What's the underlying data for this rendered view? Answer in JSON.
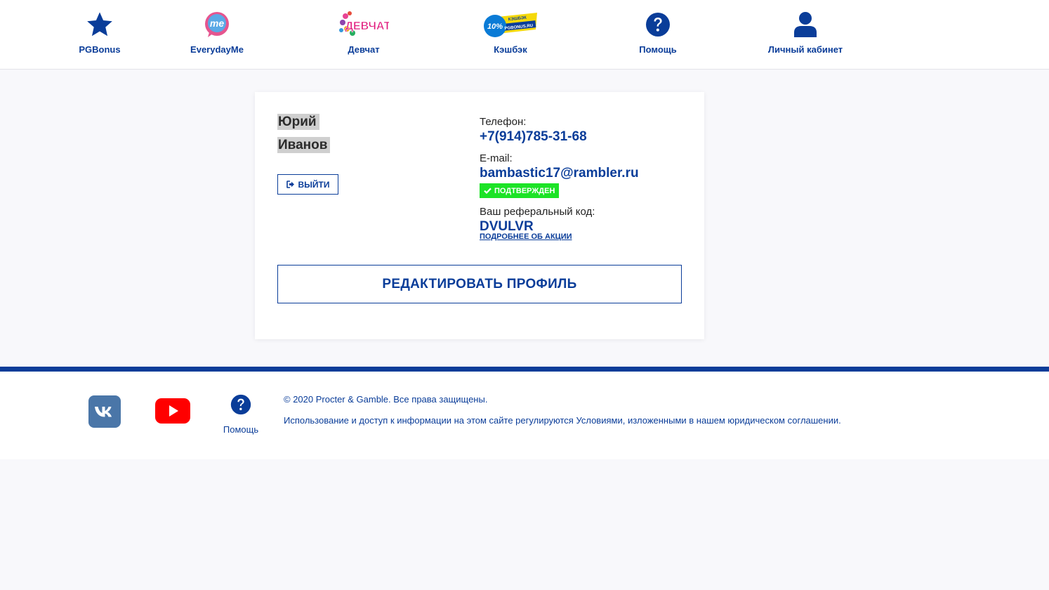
{
  "nav": {
    "items": [
      {
        "label": "PGBonus",
        "icon": "star-icon"
      },
      {
        "label": "EverydayMe",
        "icon": "everydayme-logo",
        "logo_text": "me"
      },
      {
        "label": "Девчат",
        "icon": "devchat-logo",
        "logo_text": "ДЕВЧАТ"
      },
      {
        "label": "Кэшбэк",
        "icon": "cashback-logo",
        "logo_text_big": "10%",
        "logo_text_top": "КЭШБЭК",
        "logo_text_small": "PGBONUS.RU"
      },
      {
        "label": "Помощь",
        "icon": "question-circle-icon"
      },
      {
        "label": "Личный кабинет",
        "icon": "user-icon"
      }
    ]
  },
  "profile": {
    "first_name": "Юрий",
    "last_name": "Иванов",
    "logout_label": "ВЫЙТИ",
    "phone_label": "Телефон:",
    "phone": "+7(914)785-31-68",
    "email_label": "E-mail:",
    "email": "bambastic17@rambler.ru",
    "email_status": "ПОДТВЕРЖДЕН",
    "referral_label": "Ваш реферальный код:",
    "referral_code": "DVULVR",
    "promo_link": "ПОДРОБНЕЕ ОБ АКЦИИ",
    "edit_button": "РЕДАКТИРОВАТЬ ПРОФИЛЬ"
  },
  "footer": {
    "social": [
      {
        "name": "vk",
        "icon": "vk-icon"
      },
      {
        "name": "youtube",
        "icon": "youtube-icon"
      }
    ],
    "help_label": "Помощь",
    "copyright": "© 2020 Procter & Gamble. Все права защищены.",
    "legal": "Использование и доступ к информации на этом сайте регулируются Условиями, изложенными в нашем юридическом соглашении."
  },
  "colors": {
    "brand": "#0a3d99",
    "verified": "#1ce326",
    "page_bg": "#f8f8fb",
    "vk": "#4a76a8",
    "youtube": "#ff0000"
  }
}
